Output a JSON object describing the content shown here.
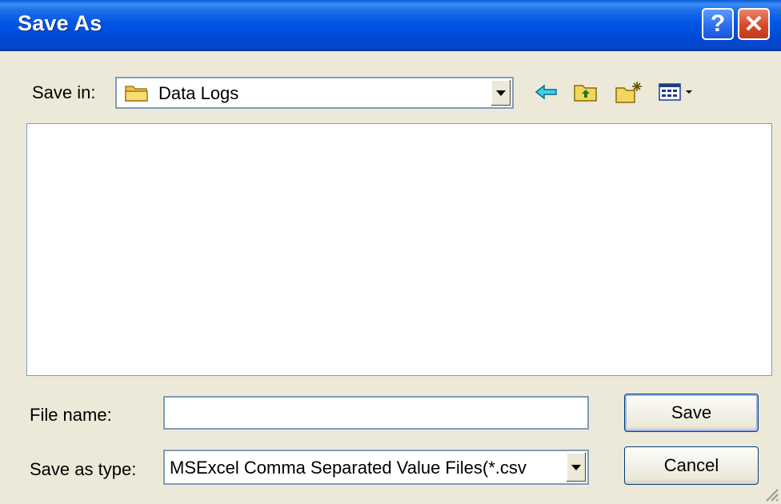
{
  "window": {
    "title": "Save As",
    "help_label": "?",
    "close_label": "✕"
  },
  "save_in": {
    "label": "Save in:",
    "value": "Data Logs",
    "icons": [
      "folder-icon",
      "back-arrow-icon",
      "up-one-level-icon",
      "create-new-folder-icon",
      "view-menu-icon"
    ]
  },
  "file_list": {
    "items": []
  },
  "file_name": {
    "label": "File name:",
    "value": ""
  },
  "save_as_type": {
    "label": "Save as type:",
    "value": "MSExcel Comma Separated Value Files(*.csv"
  },
  "buttons": {
    "save_label": "Save",
    "cancel_label": "Cancel"
  },
  "colors": {
    "titlebar": "#0055e5",
    "dialog_bg": "#ece9d8",
    "close_red": "#d8492b",
    "field_border": "#7f9db9"
  }
}
